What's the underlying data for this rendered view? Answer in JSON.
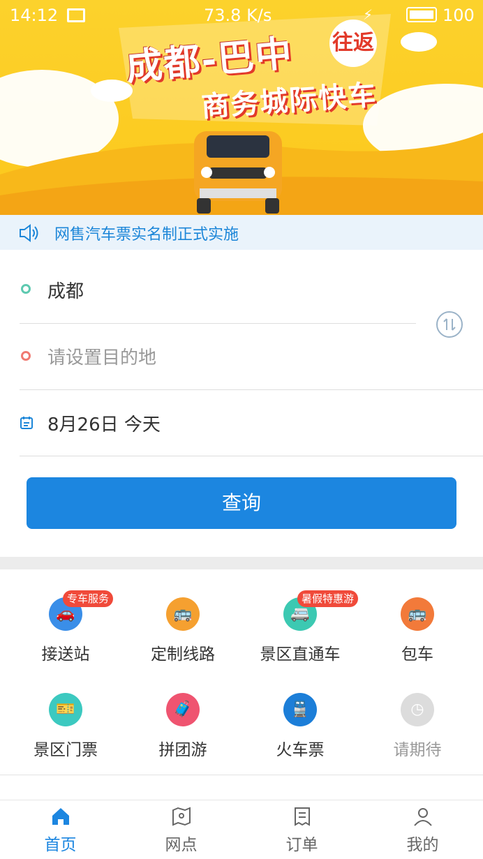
{
  "status_bar": {
    "time": "14:12",
    "speed": "73.8 K/s",
    "battery": "100"
  },
  "banner": {
    "title_line1": "成都-巴中",
    "title_line2": "商务城际快车",
    "badge": "往返"
  },
  "notice": "网售汽车票实名制正式实施",
  "form": {
    "from": "成都",
    "to_placeholder": "请设置目的地",
    "date": "8月26日 今天",
    "query_label": "查询"
  },
  "services": [
    {
      "label": "接送站",
      "badge": "专车服务",
      "color": "#3a8ee8",
      "icon": "car-icon"
    },
    {
      "label": "定制线路",
      "badge": "",
      "color": "#f5a030",
      "icon": "custom-route-icon"
    },
    {
      "label": "景区直通车",
      "badge": "暑假特惠游",
      "color": "#3cc9b2",
      "icon": "bus-icon"
    },
    {
      "label": "包车",
      "badge": "",
      "color": "#f27a3a",
      "icon": "charter-bus-icon"
    },
    {
      "label": "景区门票",
      "badge": "",
      "color": "#3cc9c0",
      "icon": "ticket-icon"
    },
    {
      "label": "拼团游",
      "badge": "",
      "color": "#ef5470",
      "icon": "luggage-icon"
    },
    {
      "label": "火车票",
      "badge": "",
      "color": "#1c7ed8",
      "icon": "train-icon"
    },
    {
      "label": "请期待",
      "badge": "",
      "color": "#dcdcdc",
      "icon": "clock-icon"
    }
  ],
  "tabs": [
    {
      "label": "首页",
      "icon": "home-icon",
      "active": true
    },
    {
      "label": "网点",
      "icon": "map-icon",
      "active": false
    },
    {
      "label": "订单",
      "icon": "order-icon",
      "active": false
    },
    {
      "label": "我的",
      "icon": "user-icon",
      "active": false
    }
  ],
  "colors": {
    "accent": "#1c86e0",
    "banner": "#fcc81c",
    "inactive_tab": "#666666",
    "disabled": "#999999"
  }
}
